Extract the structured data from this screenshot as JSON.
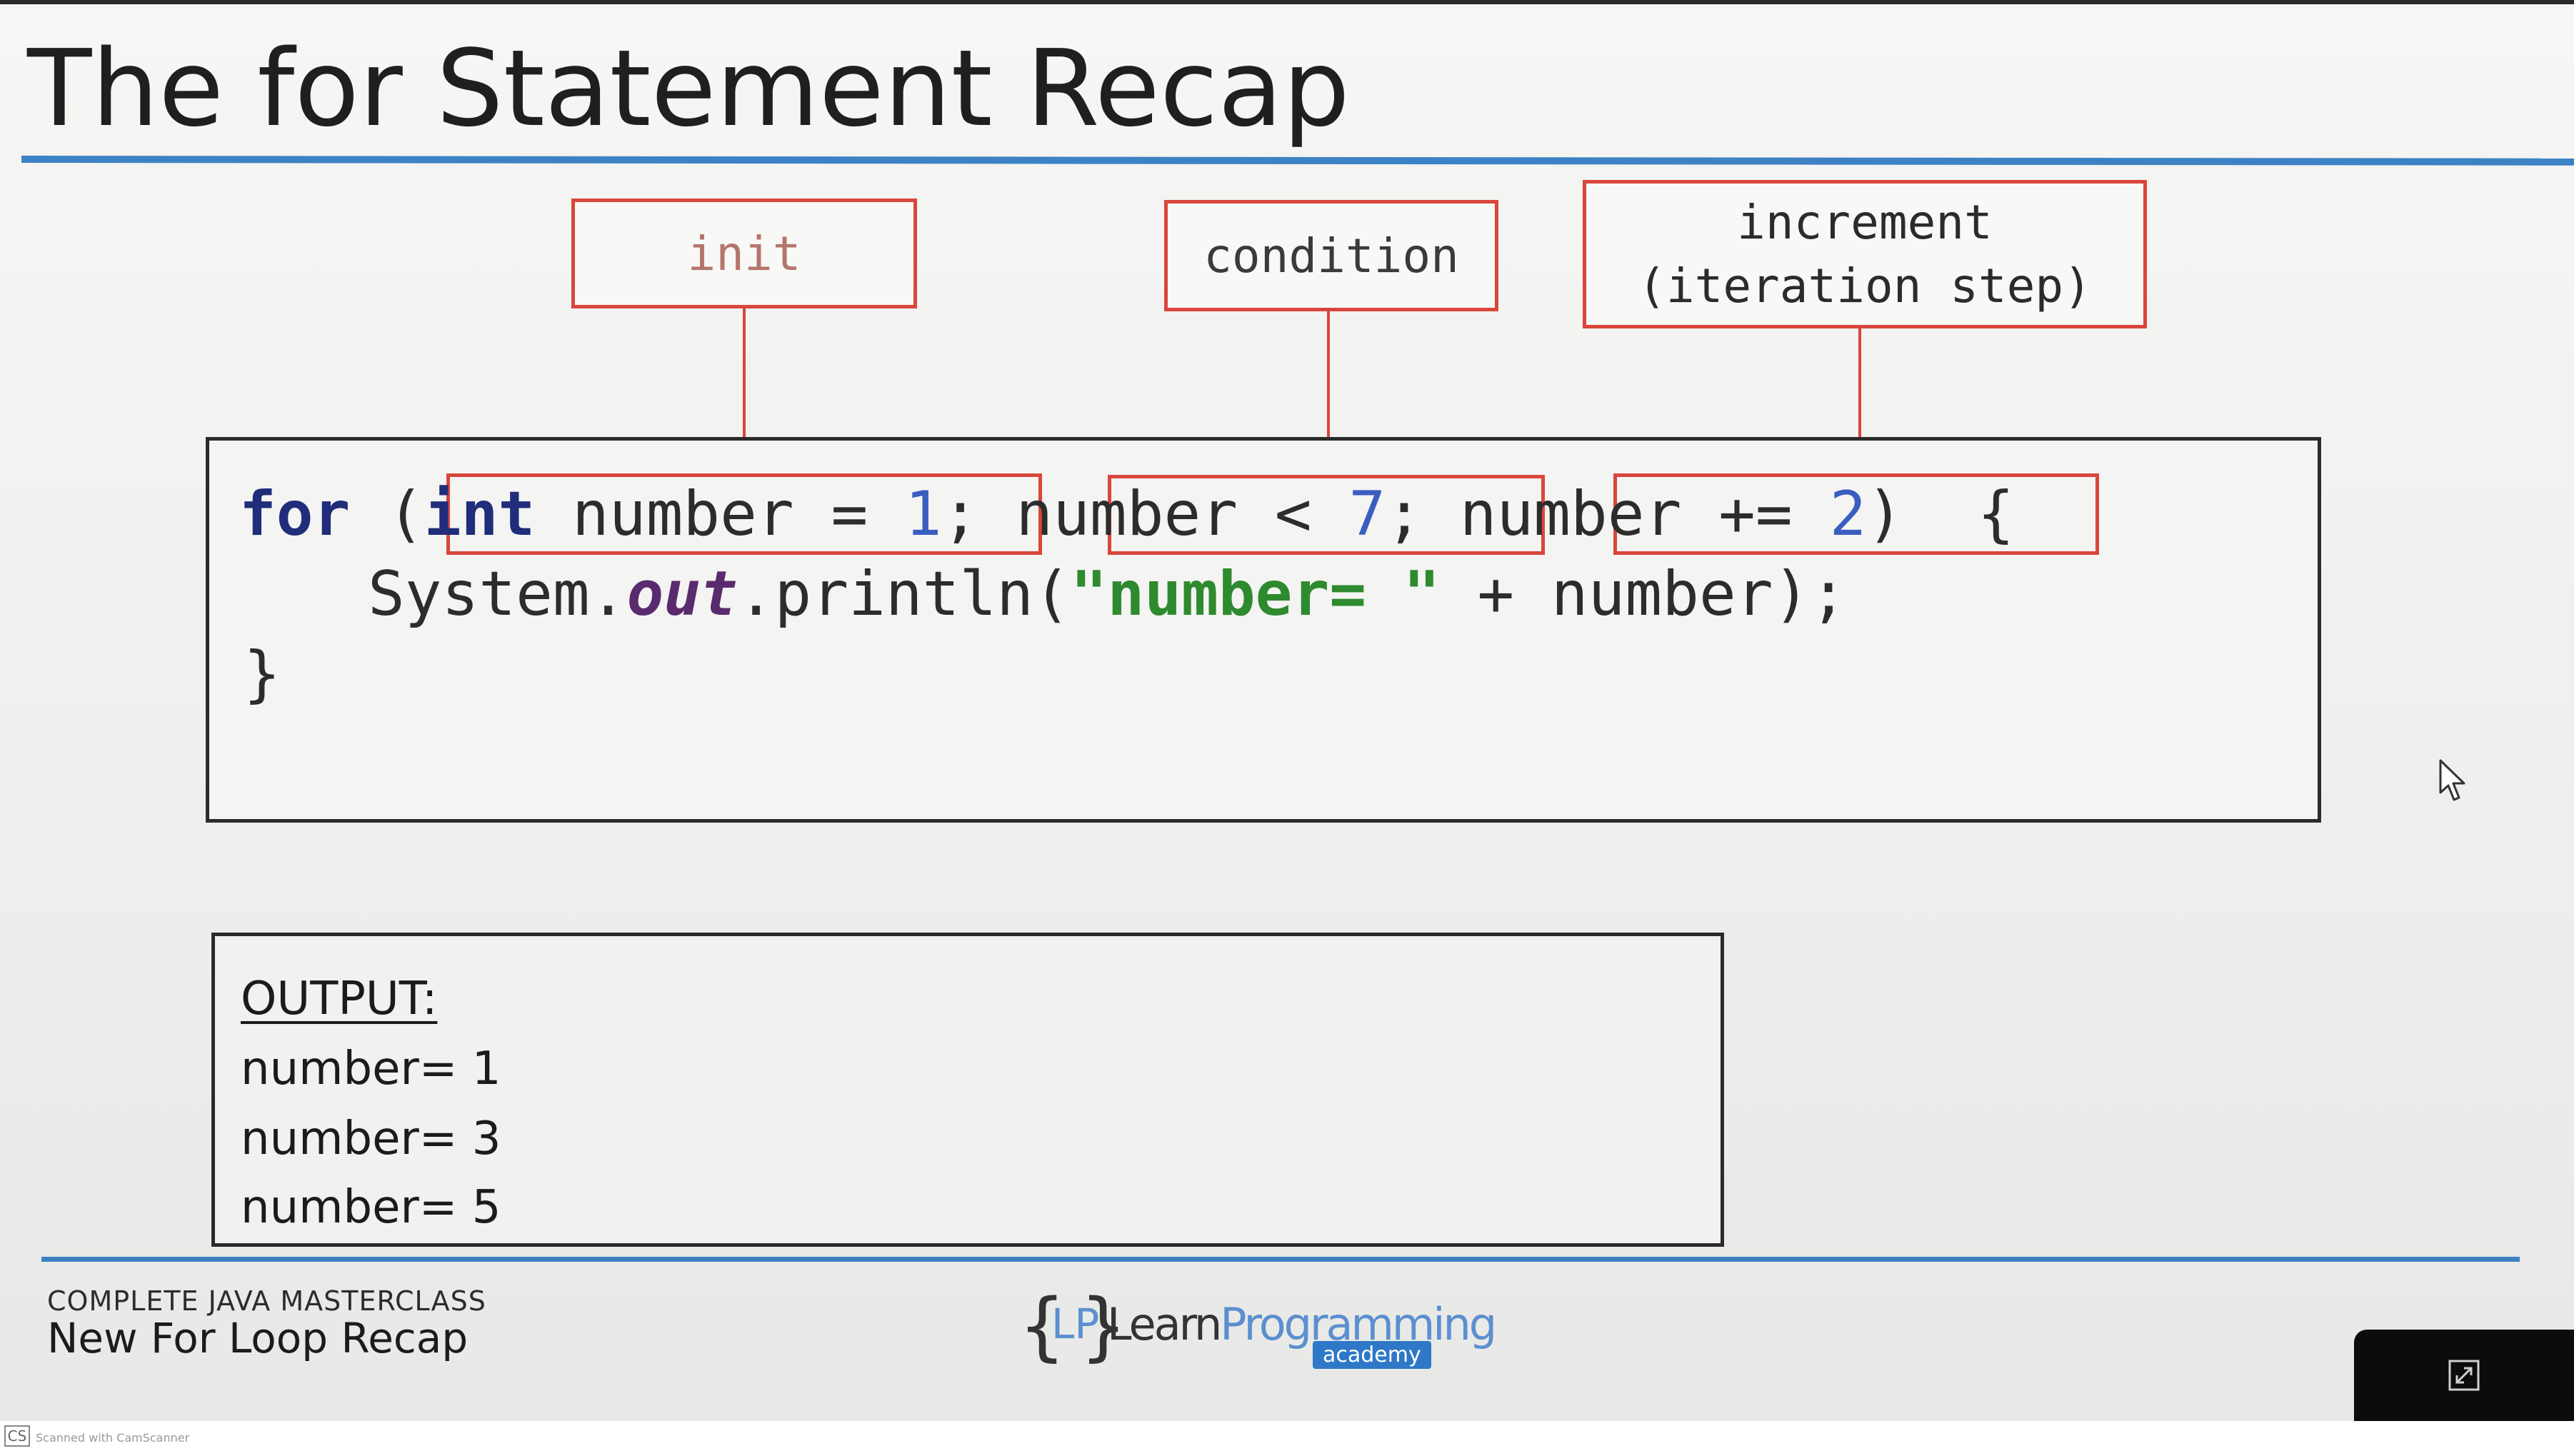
{
  "slide": {
    "title": "The for Statement Recap"
  },
  "annotations": {
    "init": "init",
    "condition": "condition",
    "increment_line1": "increment",
    "increment_line2": "(iteration step)"
  },
  "code": {
    "kw_for": "for",
    "paren_open": "(",
    "kw_int": "int",
    "init_rest": " number = ",
    "init_value": "1",
    "semi1": ";",
    "cond_text": "number < ",
    "cond_value": "7",
    "semi2": ";",
    "incr_text": "number += ",
    "incr_value": "2",
    "paren_close": ")",
    "brace_open": "{",
    "body_indent": "System.",
    "body_field": "out",
    "body_method": ".println(",
    "body_string": "\"number= \"",
    "body_rest": " + number);",
    "brace_close": "}"
  },
  "output": {
    "header": "OUTPUT:",
    "lines": [
      "number= 1",
      "number= 3",
      "number= 5"
    ]
  },
  "footer": {
    "course": "COMPLETE JAVA MASTERCLASS",
    "lesson": "New For Loop Recap",
    "logo_lp": "LP",
    "logo_learn": "Learn",
    "logo_programming": "Programming",
    "logo_academy": "academy",
    "brace_left": "{",
    "brace_right": "}"
  },
  "scanner": {
    "badge": "CS",
    "text": "Scanned with CamScanner"
  },
  "colors": {
    "accent_blue": "#3d82c4",
    "annotation_red": "#d9463b",
    "keyword": "#1f2d7a",
    "string": "#2e8a2e",
    "number": "#3a5dc0"
  },
  "icons": [
    "fullscreen-icon",
    "mouse-cursor-icon"
  ]
}
